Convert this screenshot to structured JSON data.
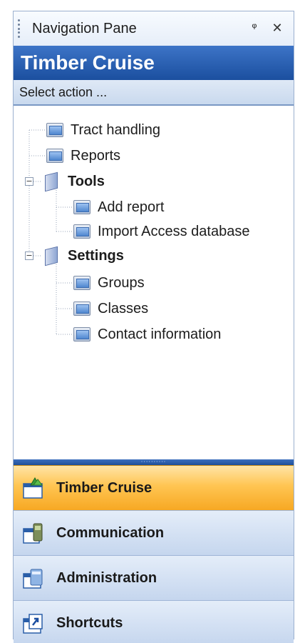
{
  "titlebar": {
    "title": "Navigation Pane",
    "pin_glyph": "ᵠ",
    "close_glyph": "✕"
  },
  "header": {
    "title": "Timber Cruise"
  },
  "select_action": {
    "label": "Select action ..."
  },
  "tree": {
    "items": [
      {
        "label": "Tract handling",
        "icon": "window-icon"
      },
      {
        "label": "Reports",
        "icon": "window-icon"
      },
      {
        "label": "Tools",
        "icon": "folder-icon",
        "expanded": true
      },
      {
        "label": "Add report",
        "icon": "window-icon"
      },
      {
        "label": "Import Access database",
        "icon": "window-icon"
      },
      {
        "label": "Settings",
        "icon": "folder-icon",
        "expanded": true
      },
      {
        "label": "Groups",
        "icon": "window-icon"
      },
      {
        "label": "Classes",
        "icon": "window-icon"
      },
      {
        "label": "Contact information",
        "icon": "window-icon"
      }
    ],
    "expander_glyph": "−"
  },
  "splitter": {
    "dots": "··········"
  },
  "nav_buttons": [
    {
      "label": "Timber Cruise",
      "icon": "timber-cruise-icon",
      "active": true
    },
    {
      "label": "Communication",
      "icon": "communication-icon",
      "active": false
    },
    {
      "label": "Administration",
      "icon": "administration-icon",
      "active": false
    },
    {
      "label": "Shortcuts",
      "icon": "shortcuts-icon",
      "active": false
    }
  ],
  "colors": {
    "header_blue": "#1b4f9f",
    "active_orange": "#ffc552",
    "button_blue": "#c5d6ee"
  }
}
